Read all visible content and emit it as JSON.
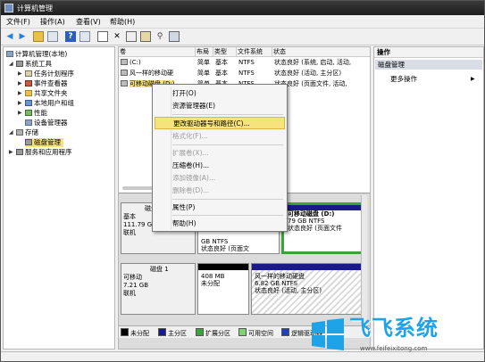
{
  "window": {
    "title": "计算机管理"
  },
  "menu": [
    "文件(F)",
    "操作(A)",
    "查看(V)",
    "帮助(H)"
  ],
  "tree": {
    "root": "计算机管理(本地)",
    "system_tools": "系统工具",
    "task_scheduler": "任务计划程序",
    "event_viewer": "事件查看器",
    "shared_folders": "共享文件夹",
    "local_users": "本地用户和组",
    "performance": "性能",
    "device_manager": "设备管理器",
    "storage": "存储",
    "disk_management": "磁盘管理",
    "services": "服务和应用程序"
  },
  "volumes": {
    "headers": [
      "卷",
      "布局",
      "类型",
      "文件系统",
      "状态"
    ],
    "rows": [
      {
        "name": "(C:)",
        "layout": "简单",
        "type": "基本",
        "fs": "NTFS",
        "status": "状态良好 (系统, 启动, 活动,"
      },
      {
        "name": "风一样的移动硬",
        "layout": "简单",
        "type": "基本",
        "fs": "NTFS",
        "status": "状态良好 (活动, 主分区)"
      },
      {
        "name": "可移动磁盘 (D:)",
        "layout": "简单",
        "type": "基本",
        "fs": "NTFS",
        "status": "状态良好 (页面文件, 活动,"
      }
    ]
  },
  "context_menu": {
    "open": "打开(O)",
    "explore": "资源管理器(E)",
    "change_letter": "更改驱动器号和路径(C)...",
    "format": "格式化(F)...",
    "extend": "扩展卷(X)...",
    "shrink": "压缩卷(H)...",
    "add_mirror": "添加镜像(A)...",
    "delete": "删除卷(D)...",
    "properties": "属性(P)",
    "help": "帮助(H)"
  },
  "disks": {
    "disk0": {
      "kind": "基本",
      "size": "111.79 GB",
      "state": "联机"
    },
    "disk0_part": {
      "size": "GB NTFS",
      "status": "状态良好 (页面文"
    },
    "disk0_removable": {
      "name": "可移动磁盘 (D:)",
      "size": "79 GB NTFS",
      "status": "状态良好 (页面文件"
    },
    "disk1": {
      "name": "磁盘 1",
      "kind": "可移动",
      "size": "7.21 GB",
      "state": "联机"
    },
    "unalloc": {
      "size": "408 MB",
      "label": "未分配"
    },
    "portable": {
      "name": "风一样的移动硬盘",
      "size": "6.82 GB NTFS",
      "status": "状态良好 (活动, 主分区)"
    }
  },
  "legend": [
    "未分配",
    "主分区",
    "扩展分区",
    "可用空间",
    "逻辑驱动器"
  ],
  "actions": {
    "header": "操作",
    "section": "磁盘管理",
    "more": "更多操作"
  },
  "watermark": {
    "brand": "飞飞系统",
    "url": "www.feifeixitong.com"
  },
  "colors": {
    "highlight": "#f7e37b",
    "primary": "#1a1a8c",
    "logical": "#2040c0",
    "free": "#4fb848",
    "unalloc": "#000000"
  }
}
